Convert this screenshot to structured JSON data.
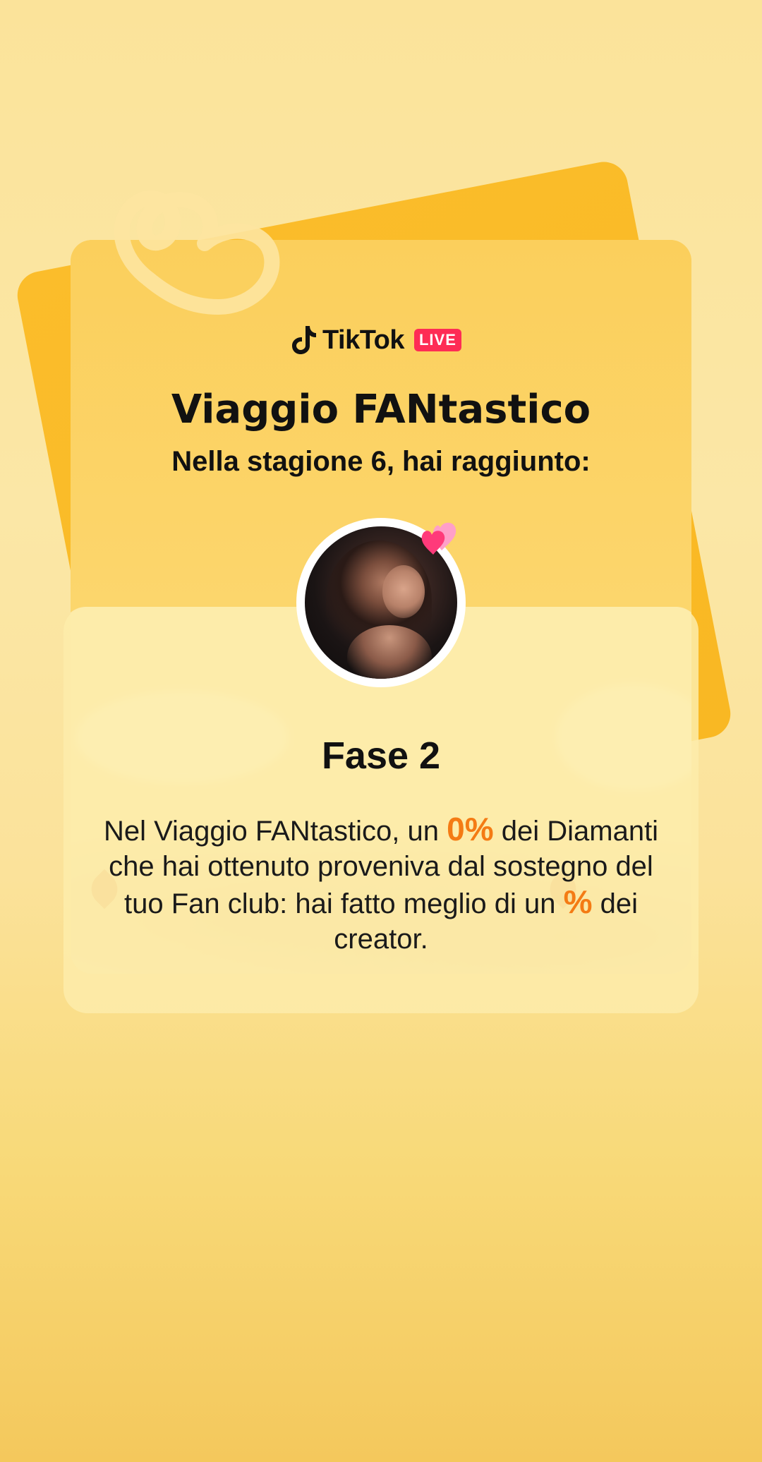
{
  "logo": {
    "fan_logo_icon": "fan-club-heart-logo",
    "brand": "TikTok",
    "badge": "LIVE"
  },
  "header": {
    "title": "Viaggio FANtastico",
    "subtitle": "Nella stagione 6, hai raggiunto:"
  },
  "profile": {
    "avatar_icon": "profile-avatar",
    "badge_icon": "fan-club-hearts-icon"
  },
  "result": {
    "phase": "Fase 2",
    "text_part1": "Nel Viaggio FANtastico, un ",
    "diamond_percent": "0%",
    "text_part2": " dei Diamanti che hai ottenuto proveniva dal sostegno del tuo Fan club: hai fatto meglio di un ",
    "creator_percent": "%",
    "text_part3": " dei creator."
  },
  "colors": {
    "background": "#fbe39a",
    "card_back": "#fbbd2b",
    "card_front": "#fcd56a",
    "highlight": "#f47b14",
    "live_badge": "#fe2c55"
  }
}
